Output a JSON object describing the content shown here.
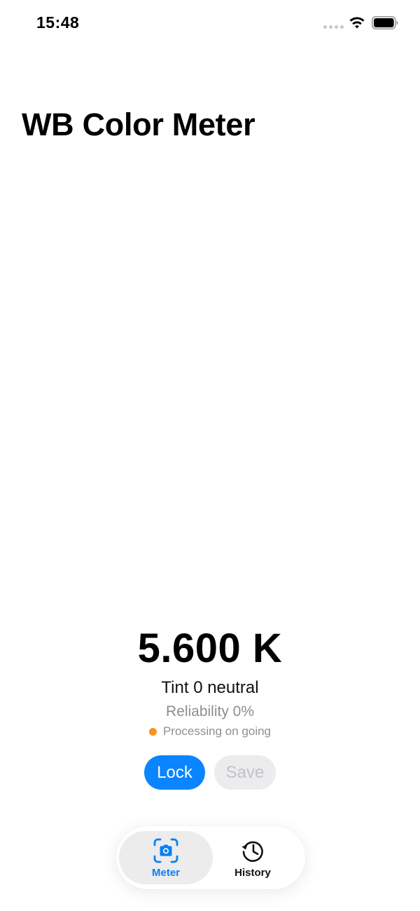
{
  "status_bar": {
    "time": "15:48",
    "wifi_icon": "wifi-icon",
    "battery_icon": "battery-icon"
  },
  "header": {
    "title": "WB Color Meter"
  },
  "readout": {
    "kelvin": "5.600 K",
    "tint": "Tint 0 neutral",
    "reliability": "Reliability 0%",
    "processing": "Processing on going"
  },
  "actions": {
    "lock_label": "Lock",
    "save_label": "Save"
  },
  "tab_bar": {
    "tabs": [
      {
        "label": "Meter",
        "icon": "camera-viewfinder-icon",
        "selected": true
      },
      {
        "label": "History",
        "icon": "history-clock-icon",
        "selected": false
      }
    ]
  },
  "colors": {
    "accent": "#0a84ff",
    "status_orange": "#f7941d",
    "secondary_text": "#8e8e93",
    "disabled_button_bg": "#ececee"
  }
}
